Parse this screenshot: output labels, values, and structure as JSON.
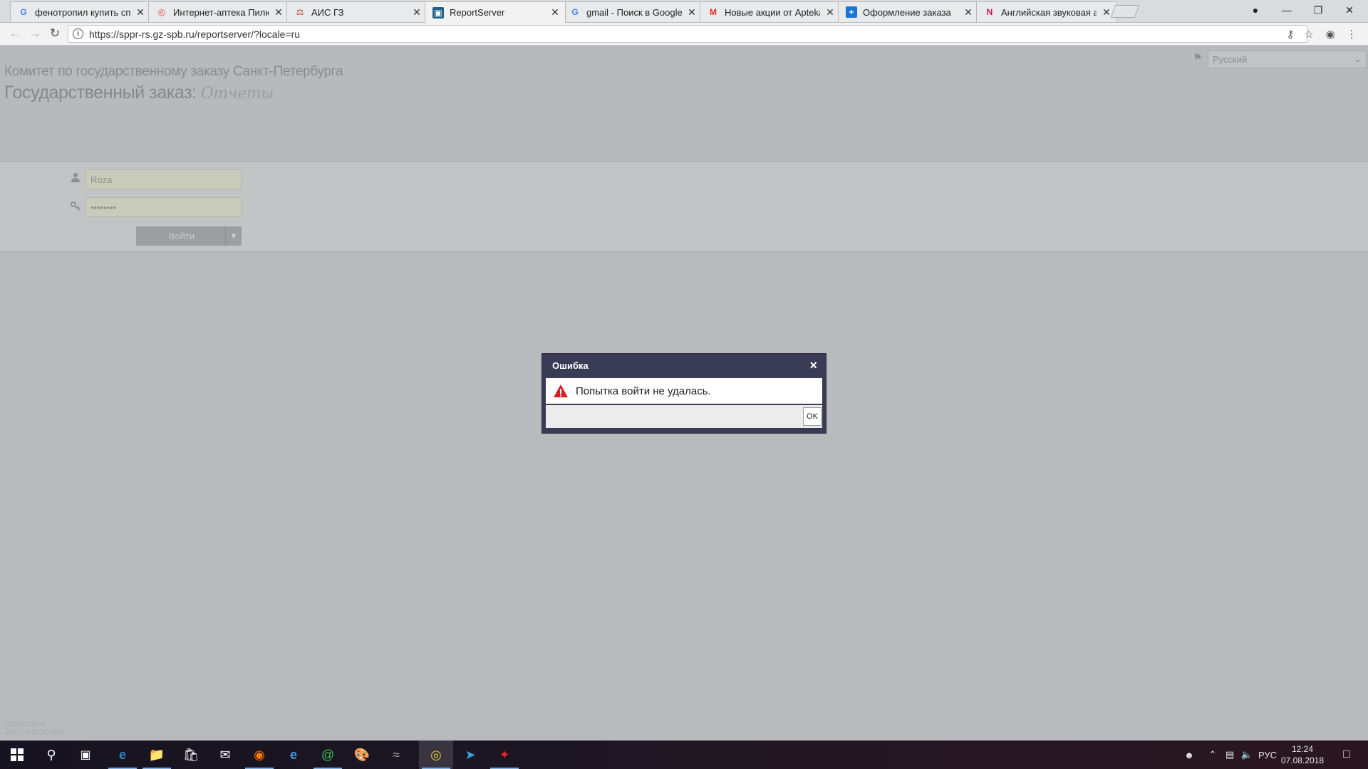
{
  "browser": {
    "tabs": [
      {
        "title": "фенотропил купить спб",
        "favicon": "google-g-icon",
        "color": "#4285f4"
      },
      {
        "title": "Интернет-аптека Пилюли",
        "favicon": "pill-icon",
        "color": "#e53935"
      },
      {
        "title": "АИС ГЗ",
        "favicon": "ais-icon",
        "color": "#c0392b"
      },
      {
        "title": "ReportServer",
        "favicon": "report-server-icon",
        "color": "#1f5f8b",
        "active": true
      },
      {
        "title": "gmail - Поиск в Google",
        "favicon": "google-g-icon",
        "color": "#4285f4"
      },
      {
        "title": "Новые акции от Apteka",
        "favicon": "gmail-m-icon",
        "color": "#d93025"
      },
      {
        "title": "Оформление заказа",
        "favicon": "plus-cross-icon",
        "color": "#1976d2"
      },
      {
        "title": "Английская звуковая азбука",
        "favicon": "nini-icon",
        "color": "#c2185b"
      }
    ],
    "url": "https://sppr-rs.gz-spb.ru/reportserver/?locale=ru"
  },
  "header": {
    "org_name": "Комитет по государственному заказу Санкт-Петербурга",
    "site_title": "Государственный заказ:",
    "site_subtitle_script": "Отчеты",
    "language": "Русский"
  },
  "login": {
    "username": "Roza",
    "password_masked": "••••••••",
    "submit_label": "Войти"
  },
  "version": {
    "line1": "RS3.0.3.8000",
    "line2": "2017-10-25 19:15:32"
  },
  "dialog": {
    "title": "Ошибка",
    "message": "Попытка войти не удалась.",
    "ok_label": "OK",
    "close_glyph": "×"
  },
  "taskbar": {
    "language": "РУС",
    "time": "12:24",
    "date": "07.08.2018"
  }
}
